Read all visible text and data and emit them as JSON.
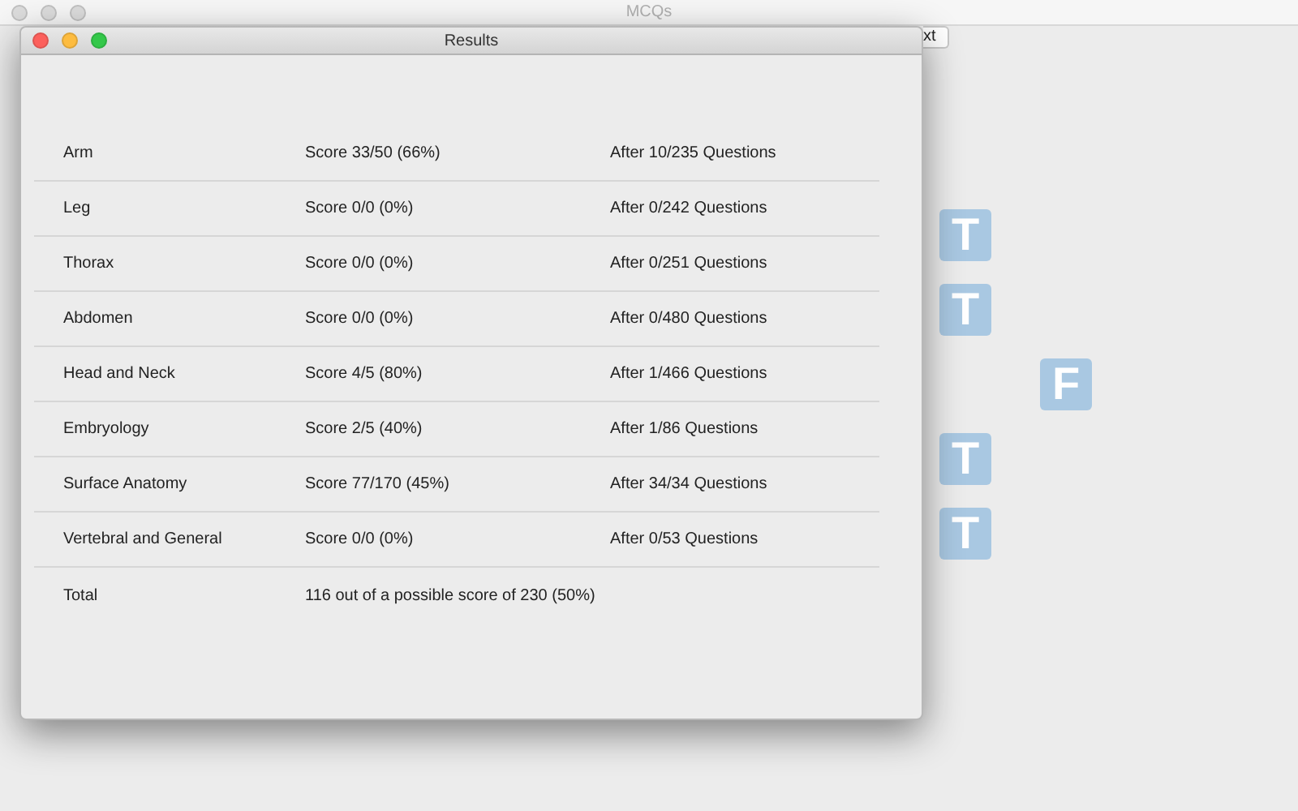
{
  "main_window": {
    "title": "MCQs",
    "partial_button": "xt",
    "answers": [
      {
        "kind": "true",
        "letter": "T"
      },
      {
        "kind": "true",
        "letter": "T"
      },
      {
        "kind": "false",
        "letter": "F"
      },
      {
        "kind": "true",
        "letter": "T"
      },
      {
        "kind": "true",
        "letter": "T"
      }
    ]
  },
  "results_window": {
    "title": "Results",
    "rows": [
      {
        "topic": "Arm",
        "score": "Score 33/50 (66%)",
        "progress": "After 10/235 Questions"
      },
      {
        "topic": "Leg",
        "score": "Score 0/0 (0%)",
        "progress": "After 0/242 Questions"
      },
      {
        "topic": "Thorax",
        "score": "Score 0/0 (0%)",
        "progress": "After 0/251 Questions"
      },
      {
        "topic": "Abdomen",
        "score": "Score 0/0 (0%)",
        "progress": "After 0/480 Questions"
      },
      {
        "topic": "Head and Neck",
        "score": "Score 4/5 (80%)",
        "progress": "After 1/466 Questions"
      },
      {
        "topic": "Embryology",
        "score": "Score 2/5 (40%)",
        "progress": "After 1/86 Questions"
      },
      {
        "topic": "Surface Anatomy",
        "score": "Score 77/170 (45%)",
        "progress": "After 34/34 Questions"
      },
      {
        "topic": "Vertebral and General",
        "score": "Score 0/0 (0%)",
        "progress": "After 0/53 Questions"
      }
    ],
    "total": {
      "label": "Total",
      "summary": "116 out of a possible score of 230 (50%)"
    }
  }
}
